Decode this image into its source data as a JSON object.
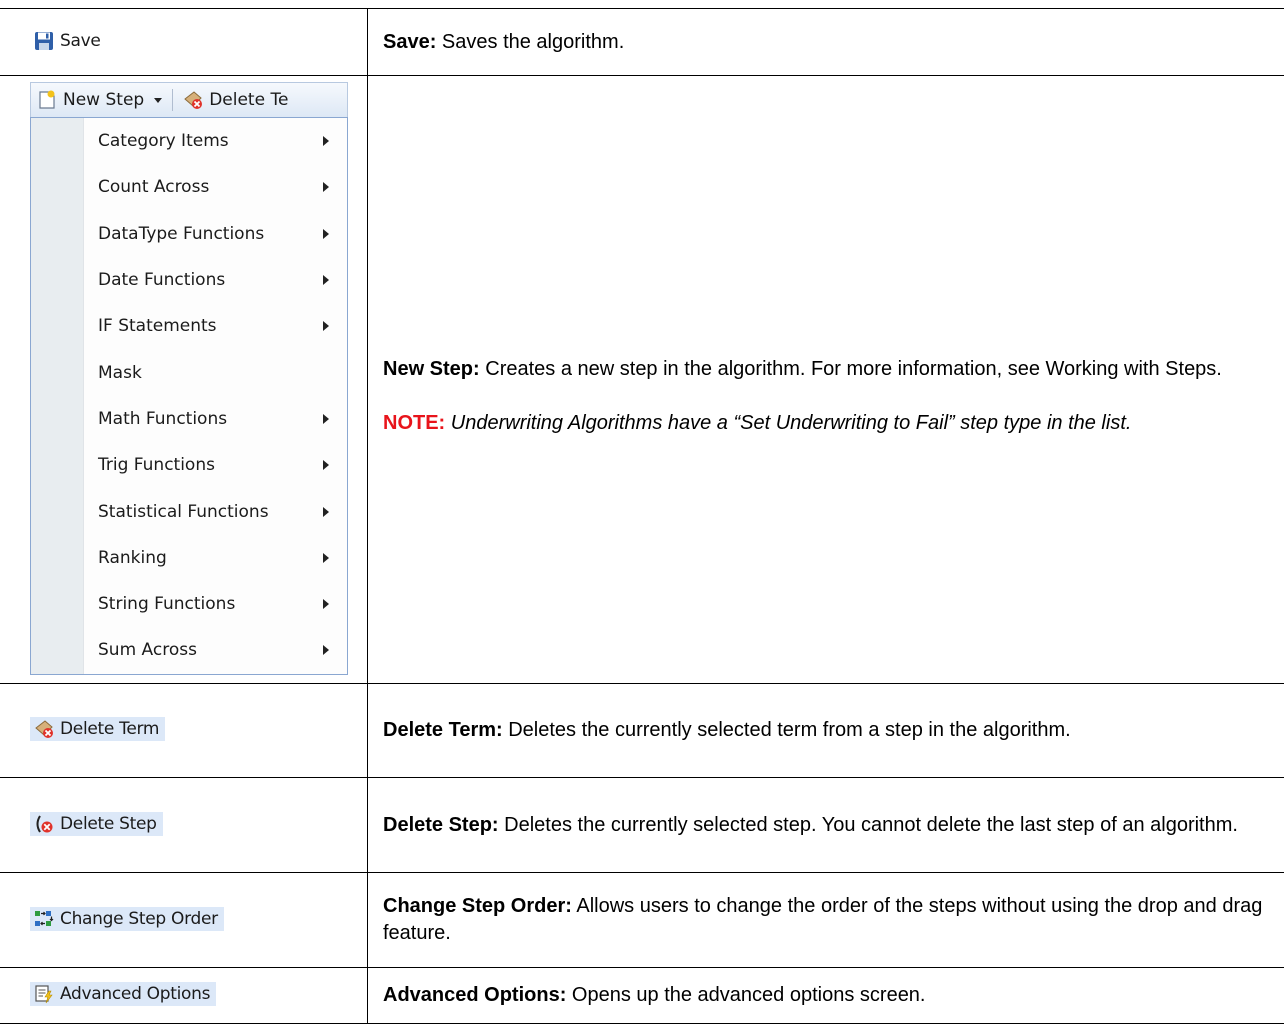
{
  "rows": {
    "save": {
      "button_label": "Save",
      "term": "Save:",
      "desc": " Saves the algorithm."
    },
    "new_step": {
      "toolbar": {
        "new_step_label": "New Step",
        "delete_term_partial": "Delete Te"
      },
      "menu_items": [
        {
          "label": "Category Items",
          "has_submenu": true
        },
        {
          "label": "Count Across",
          "has_submenu": true
        },
        {
          "label": "DataType Functions",
          "has_submenu": true
        },
        {
          "label": "Date Functions",
          "has_submenu": true
        },
        {
          "label": "IF Statements",
          "has_submenu": true
        },
        {
          "label": "Mask",
          "has_submenu": false
        },
        {
          "label": "Math Functions",
          "has_submenu": true
        },
        {
          "label": "Trig Functions",
          "has_submenu": true
        },
        {
          "label": "Statistical Functions",
          "has_submenu": true
        },
        {
          "label": "Ranking",
          "has_submenu": true
        },
        {
          "label": "String Functions",
          "has_submenu": true
        },
        {
          "label": "Sum Across",
          "has_submenu": true
        }
      ],
      "term": "New Step:",
      "desc": " Creates a new step in the algorithm. For more information, see Working with Steps.",
      "note_label": "NOTE:",
      "note_text": " Underwriting Algorithms have a “Set Underwriting to Fail” step type in the list."
    },
    "delete_term": {
      "button_label": "Delete Term",
      "term": "Delete Term:",
      "desc": " Deletes the currently selected term from a step in the algorithm."
    },
    "delete_step": {
      "button_label": "Delete Step",
      "term": "Delete Step:",
      "desc": " Deletes the currently selected step. You cannot delete the last step of an algorithm."
    },
    "change_order": {
      "button_label": "Change Step Order",
      "term": "Change Step Order:",
      "desc": " Allows users to change the order of the steps without using the drop and drag feature."
    },
    "advanced": {
      "button_label": "Advanced Options",
      "term": "Advanced Options:",
      "desc": " Opens up the advanced options screen."
    }
  },
  "colors": {
    "note": "#e8141b",
    "button_highlight": "#dce8f8",
    "menu_border": "#8aa7d1",
    "menu_gutter": "#e8edf0"
  },
  "icons": [
    "floppy-disk-icon",
    "new-document-icon",
    "dropdown-caret-icon",
    "delete-term-icon",
    "delete-step-icon",
    "change-order-icon",
    "advanced-options-icon",
    "submenu-arrow-icon"
  ]
}
